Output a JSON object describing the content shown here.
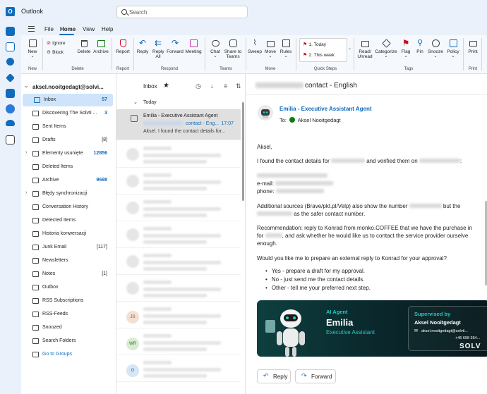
{
  "app": {
    "title": "Outlook",
    "logo_letter": "O"
  },
  "search": {
    "placeholder": "Search"
  },
  "menu": {
    "tabs": [
      "File",
      "Home",
      "View",
      "Help"
    ],
    "active": "Home"
  },
  "ribbon": {
    "buttons": {
      "new": "New",
      "ignore": "Ignore",
      "block": "Block",
      "delete": "Delete",
      "archive": "Archive",
      "report": "Report",
      "reply": "Reply",
      "reply_all": "Reply All",
      "forward": "Forward",
      "meeting": "Meeting",
      "chat": "Chat",
      "share_to_teams": "Share to Teams",
      "sweep": "Sweep",
      "move": "Move",
      "rules": "Rules",
      "read_unread": "Read/ Unread",
      "categorize": "Categorize",
      "flag": "Flag",
      "pin": "Pin",
      "snooze": "Snooze",
      "policy": "Policy",
      "print": "Print"
    },
    "quick_steps": [
      "1. Today",
      "2. This week"
    ],
    "groups": [
      "New",
      "Delete",
      "Report",
      "Respond",
      "Teams",
      "Move",
      "Quick Steps",
      "Tags",
      "Print"
    ]
  },
  "folders": {
    "account": "aksel.nooitgedagt@solvi...",
    "items": [
      {
        "name": "Inbox",
        "count": "57",
        "count_style": "blue",
        "selected": true
      },
      {
        "name": "Discovering The Solvti ...",
        "count": "3",
        "count_style": "blue"
      },
      {
        "name": "Sent Items",
        "count": ""
      },
      {
        "name": "Drafts",
        "count": "[8]"
      },
      {
        "name": "Elementy usunięte",
        "count": "12856",
        "count_style": "blue",
        "expandable": true
      },
      {
        "name": "Deleted Items",
        "count": ""
      },
      {
        "name": "Archive",
        "count": "9698",
        "count_style": "blue"
      },
      {
        "name": "Błędy synchronizacji",
        "count": "",
        "expandable": true
      },
      {
        "name": "Conversation History",
        "count": ""
      },
      {
        "name": "Detected Items",
        "count": ""
      },
      {
        "name": "Historia konwersacji",
        "count": ""
      },
      {
        "name": "Junk Email",
        "count": "[117]"
      },
      {
        "name": "Newsletters",
        "count": ""
      },
      {
        "name": "Notes",
        "count": "[1]"
      },
      {
        "name": "Outbox",
        "count": ""
      },
      {
        "name": "RSS Subscriptions",
        "count": ""
      },
      {
        "name": "RSS-Feeds",
        "count": ""
      },
      {
        "name": "Snoozed",
        "count": ""
      },
      {
        "name": "Search Folders",
        "count": ""
      },
      {
        "name": "Go to Groups",
        "count": "",
        "link": true
      }
    ]
  },
  "list": {
    "title": "Inbox",
    "group": "Today",
    "selected_message": {
      "sender": "Emilia - Executive Assistant Agent",
      "subject_suffix": "contact - Eng...",
      "time": "17:07",
      "preview": "Aksel. I found the contact details for..."
    },
    "avatars": [
      {
        "initials": "JS",
        "color": "#f3e0d3",
        "text_color": "#8a4a22"
      },
      {
        "initials": "WR",
        "color": "#d9ecd2",
        "text_color": "#3b6e22"
      },
      {
        "initials": "G",
        "color": "#d5e6f6",
        "text_color": "#1f5e9c"
      }
    ]
  },
  "reading": {
    "subject_suffix": "contact - English",
    "sender": "Emilia - Executive Assistant Agent",
    "to_label": "To:",
    "to_name": "Aksel Nooitgedagt",
    "greeting": "Aksel,",
    "line1_start": "I found the contact details for",
    "line1_mid": "and verified them on",
    "line1_end": ":",
    "email_label": "e-mail:",
    "phone_label": "phone:",
    "additional_1": "Additional sources (Brave/pkt.pl/Velp) also show the number",
    "additional_1_end": "but the",
    "additional_2": "as the safer contact number.",
    "rec_1": "Recommendation: reply to Konrad from monko.COFFEE that we have the purchase in",
    "rec_2_start": "for",
    "rec_2_end": ", and ask whether he would like us to contact the service provider ourselve",
    "rec_3": "enough.",
    "question": "Would you like me to prepare an external reply to Konrad for your approval?",
    "options": [
      "Yes - prepare a draft for my approval.",
      "No - just send me the contact details.",
      "Other - tell me your preferred next step."
    ],
    "banner": {
      "kicker": "AI Agent",
      "name": "Emilia",
      "role": "Executive Assistant",
      "card_kicker": "Supervised by",
      "card_name": "Aksel Nooitgedagt",
      "card_email": "aksel.nooitgedagt@solvti...",
      "card_phone": "+46 698 364...",
      "card_logo": "SOLV"
    },
    "reply_label": "Reply",
    "forward_label": "Forward"
  },
  "colors": {
    "accent": "#0f6cbd",
    "selected": "#cfe4fa",
    "banner_teal": "#25c9c1"
  }
}
